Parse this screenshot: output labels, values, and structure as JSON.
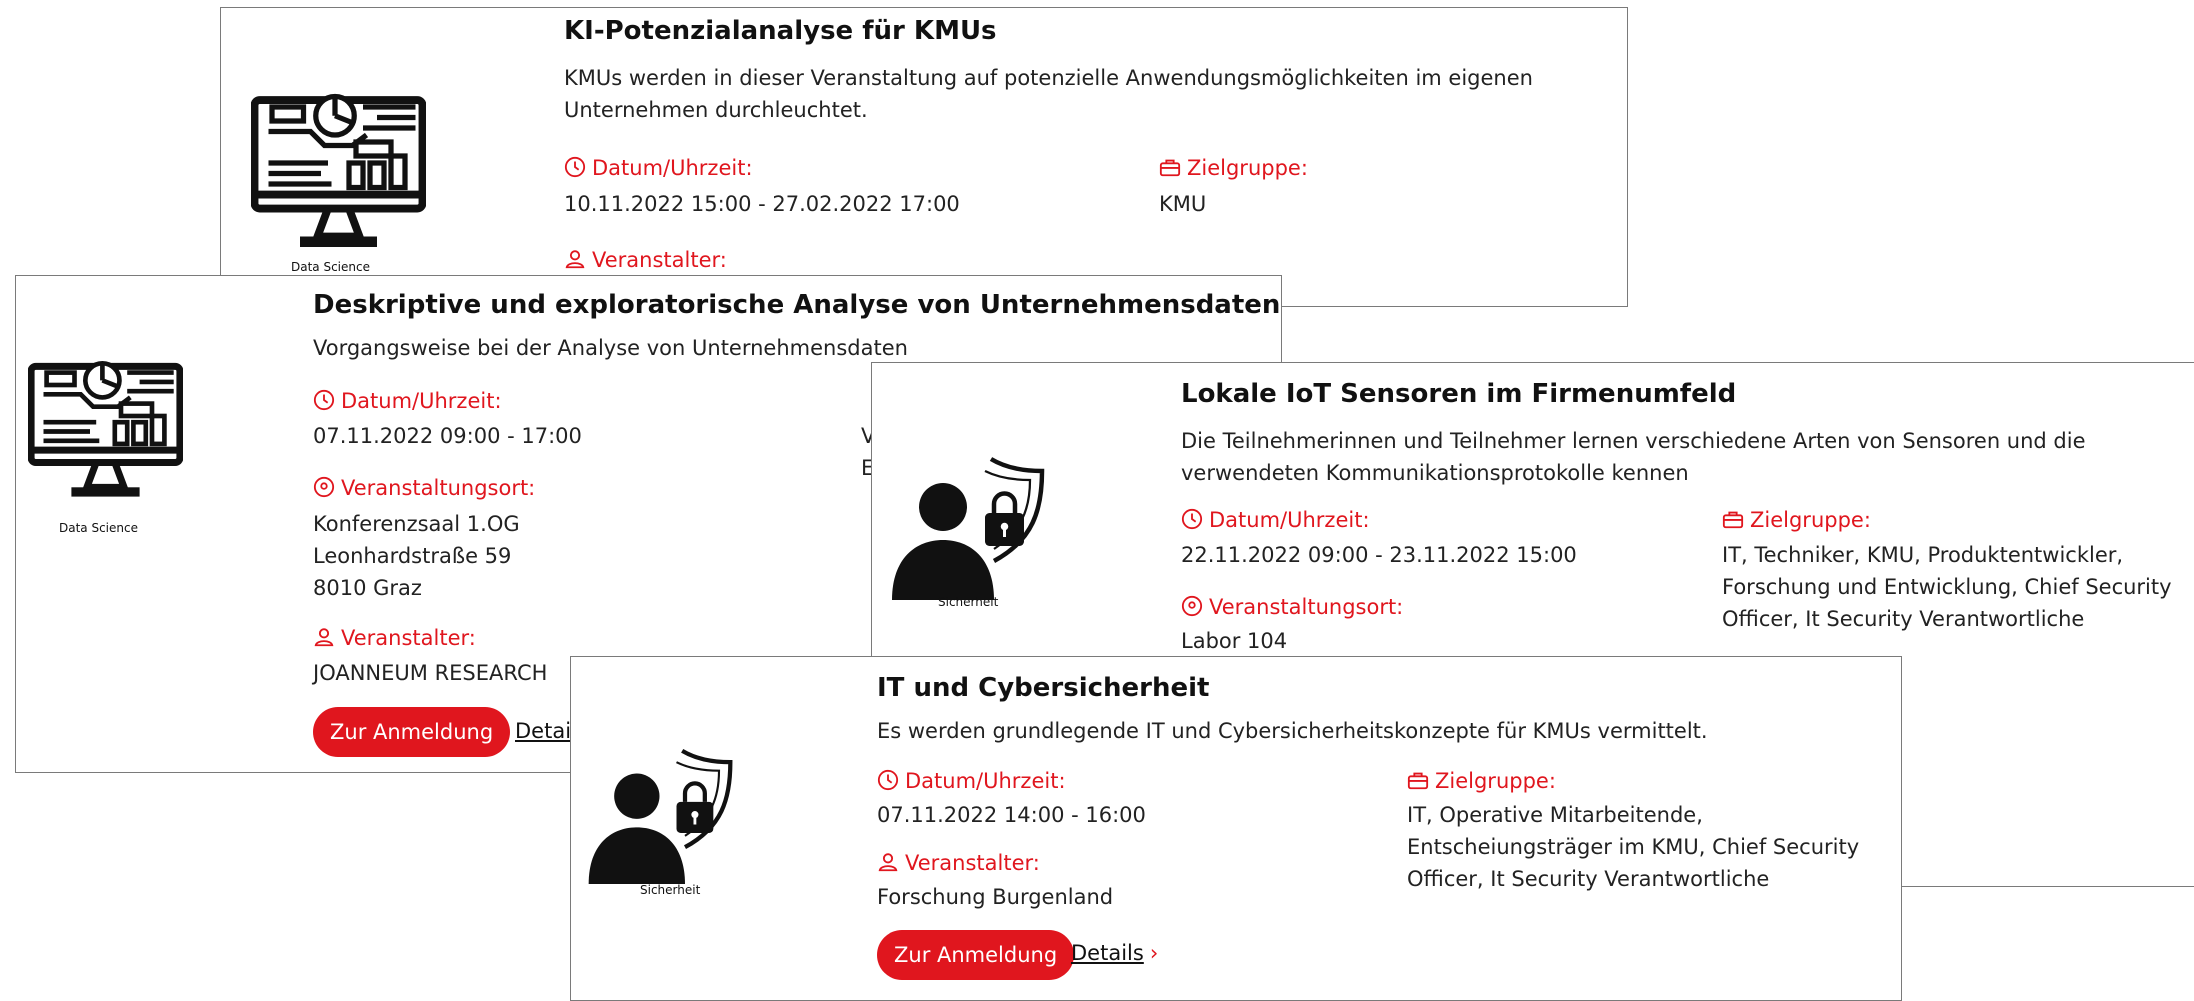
{
  "labels": {
    "date": "Datum/Uhrzeit:",
    "audience": "Zielgruppe:",
    "organizer": "Veranstalter:",
    "location": "Veranstaltungsort:",
    "register": "Zur Anmeldung",
    "details": "Details"
  },
  "accent_color": "#e0161e",
  "cards": [
    {
      "title": "KI-Potenzialanalyse für KMUs",
      "description": "KMUs werden in dieser Veranstaltung auf potenzielle Anwendungsmöglichkeiten im eigenen Unternehmen durchleuchtet.",
      "category": "Data Science",
      "icon": "data-science-icon",
      "date": "10.11.2022 15:00 - 27.02.2022 17:00",
      "audience": "KMU"
    },
    {
      "title": "Deskriptive und exploratorische Analyse von Unternehmensdaten",
      "description": "Vorgangsweise bei der Analyse von Unternehmensdaten",
      "category": "Data Science",
      "icon": "data-science-icon",
      "date": "07.11.2022 09:00 - 17:00",
      "location_lines": [
        "Konferenzsaal 1.OG",
        "Leonhardstraße 59",
        "8010 Graz"
      ],
      "organizer": "JOANNEUM RESEARCH",
      "partial_audience_1": "V",
      "partial_audience_2": "E",
      "details_partial": "Detail"
    },
    {
      "title": "Lokale IoT Sensoren im Firmenumfeld",
      "description": "Die Teilnehmerinnen und Teilnehmer lernen verschiedene Arten von Sensoren und die verwendeten Kommunikationsprotokolle kennen",
      "category": "Sicherheit",
      "icon": "security-user-lock-icon",
      "date": "22.11.2022 09:00 - 23.11.2022 15:00",
      "audience": "IT, Techniker, KMU, Produktentwickler, Forschung und Entwicklung, Chief Security Officer, It Security Verantwortliche",
      "location": "Labor 104"
    },
    {
      "title": "IT und Cybersicherheit",
      "description": "Es werden grundlegende IT und Cybersicherheitskonzepte für KMUs vermittelt.",
      "category": "Sicherheit",
      "icon": "security-user-lock-icon",
      "date": "07.11.2022 14:00 - 16:00",
      "audience": "IT, Operative Mitarbeitende, Entscheiungsträger im KMU, Chief Security Officer, It Security Verantwortliche",
      "organizer": "Forschung Burgenland"
    }
  ]
}
